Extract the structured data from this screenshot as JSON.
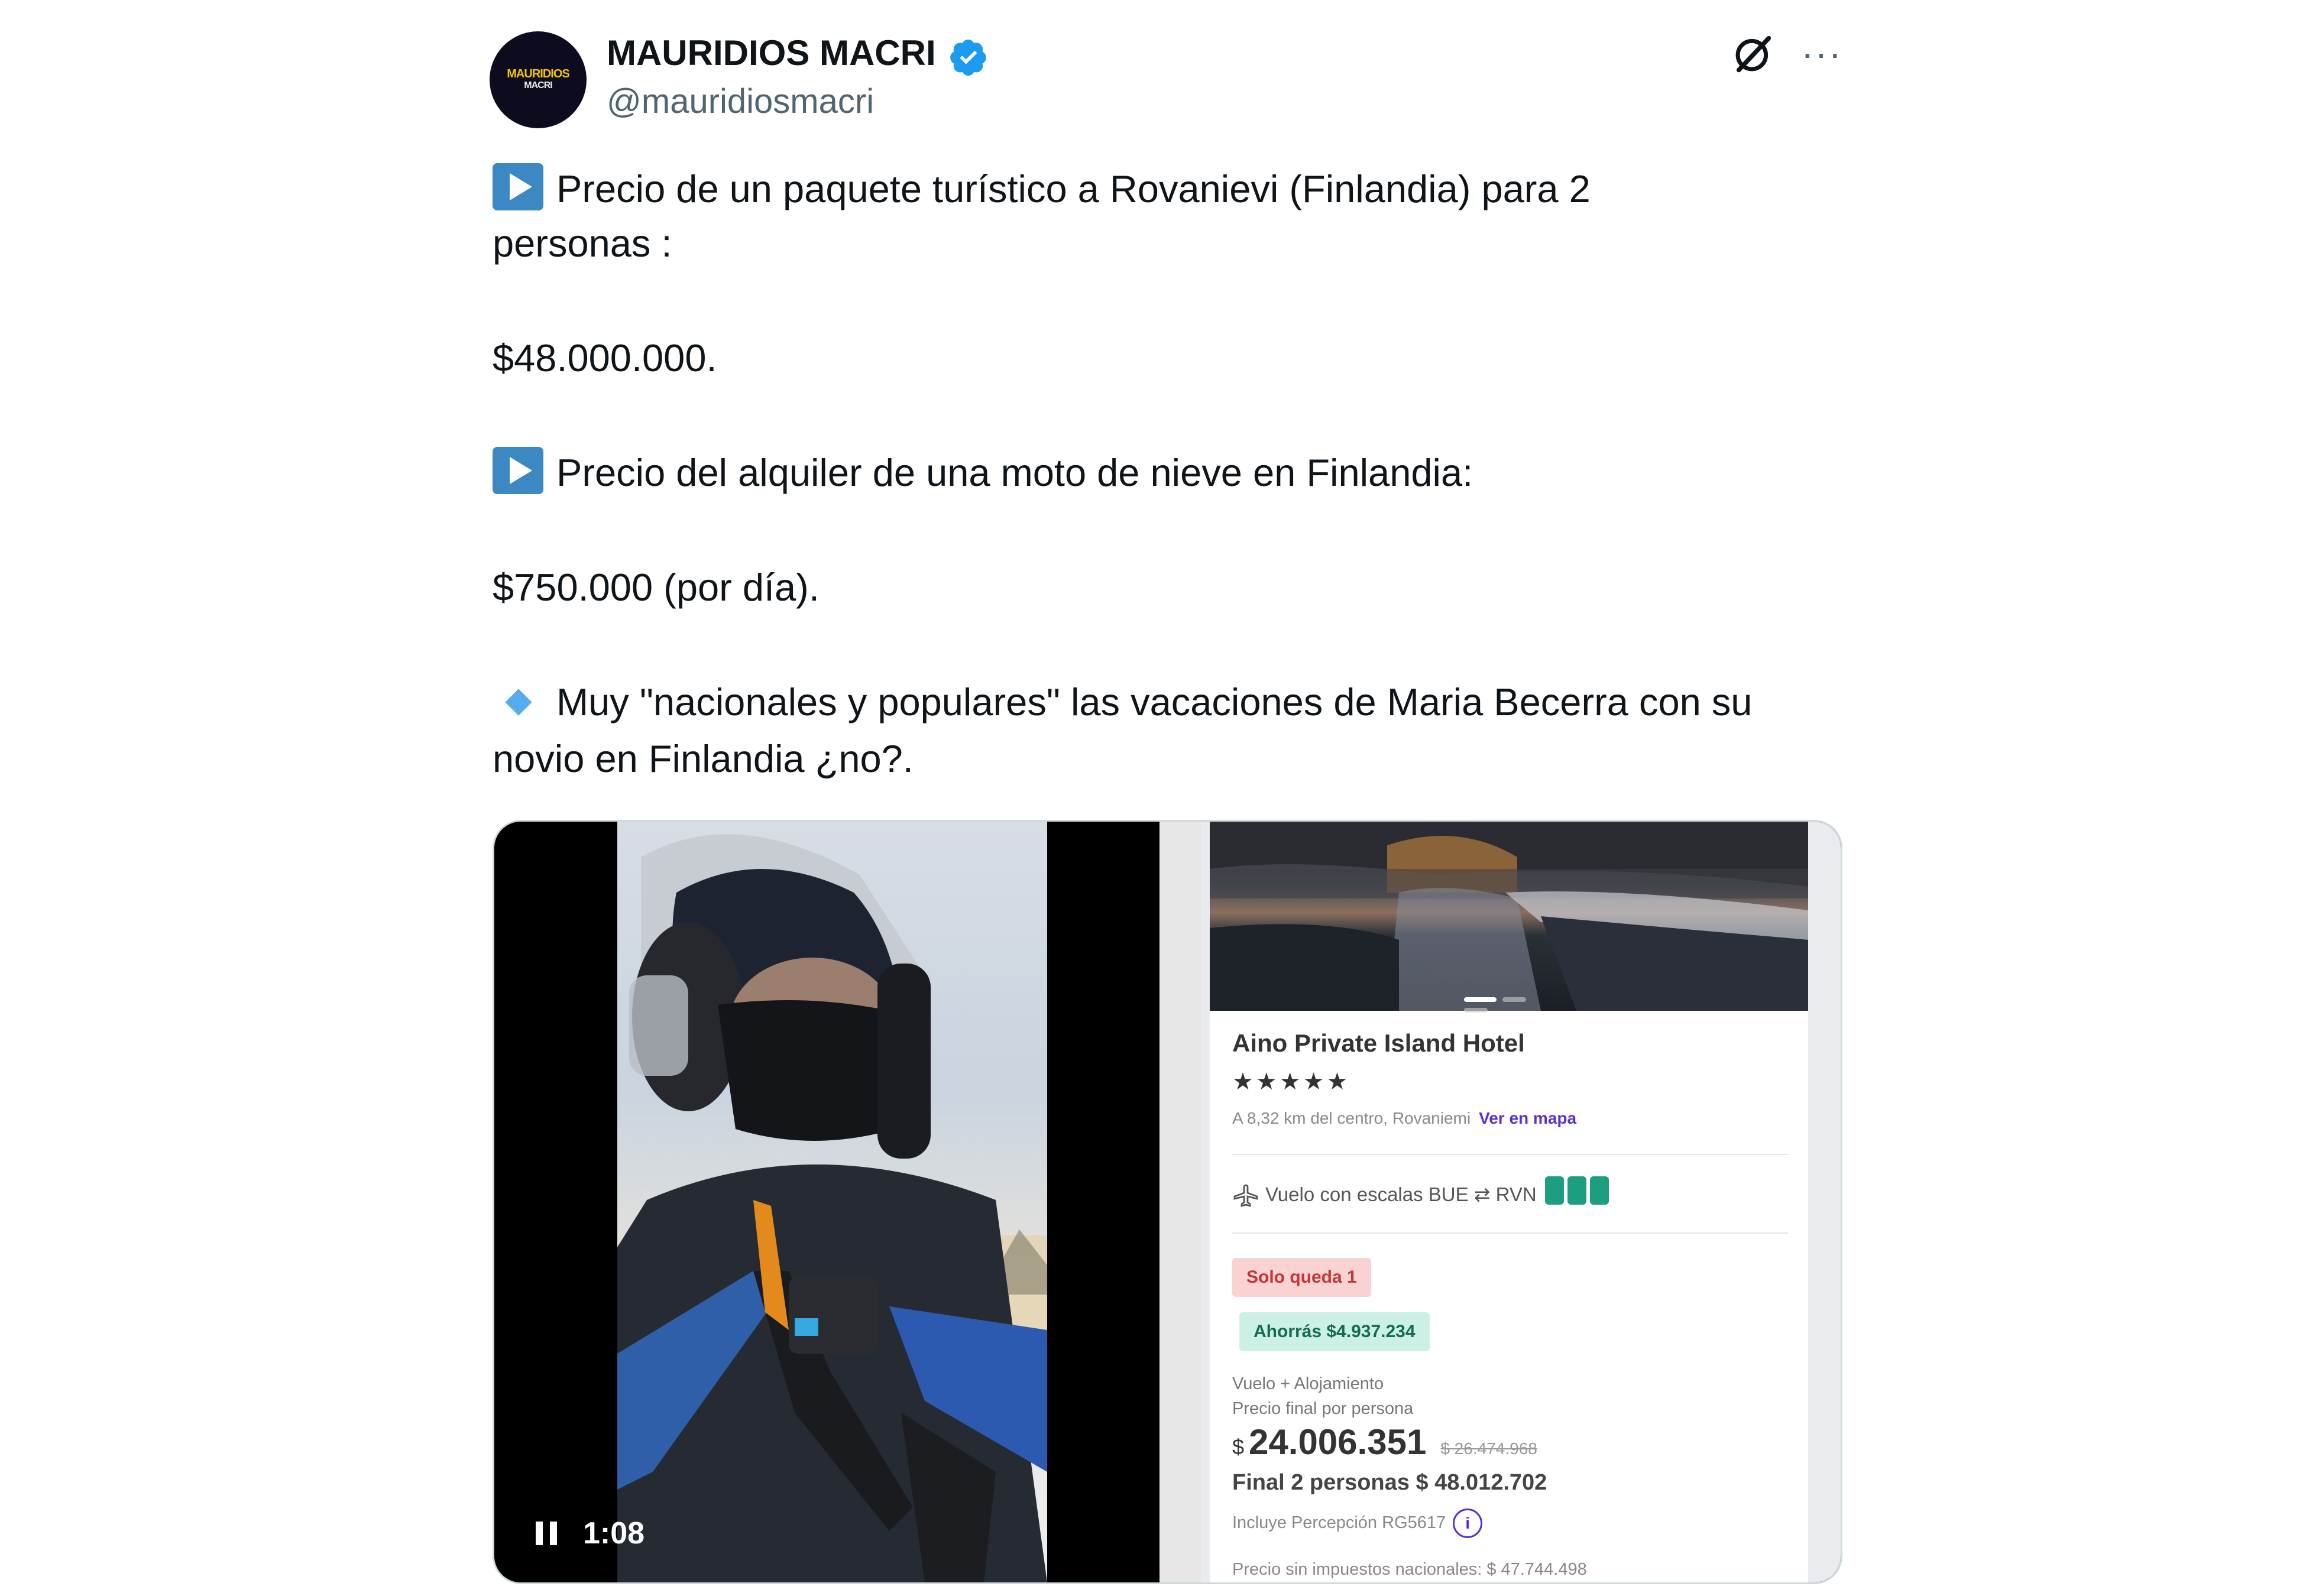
{
  "author": {
    "name": "MAURIDIOS MACRI",
    "handle": "@mauridiosmacri",
    "avatar_text_top": "MAURIDIOS",
    "avatar_text_bottom": "MACRI",
    "verified": true
  },
  "tweet": {
    "line1": "Precio de un paquete turístico a Rovanievi (Finlandia) para 2",
    "line2": "personas :",
    "line3": "$48.000.000.",
    "line4": "Precio del alquiler de una moto de nieve en Finlandia:",
    "line5": "$750.000 (por día).",
    "line6": "Muy \"nacionales y populares\" las vacaciones de Maria Becerra con su",
    "line7": "novio en Finlandia ¿no?."
  },
  "video": {
    "time": "1:08"
  },
  "hotel": {
    "title": "Aino Private Island Hotel",
    "stars": "★★★★★",
    "distance": "A 8,32 km del centro, Rovaniemi",
    "map_link": "Ver en mapa",
    "flight": "Vuelo con escalas BUE ⇄ RVN",
    "only_left": "Solo queda 1",
    "savings": "Ahorrás $4.937.234",
    "package": "Vuelo + Alojamiento",
    "per_person_label": "Precio final por persona",
    "currency": "$",
    "price": "24.006.351",
    "old_price": "$ 26.474.968",
    "final_two": "Final 2 personas $ 48.012.702",
    "includes": "Incluye Percepción RG5617",
    "info_icon": "i",
    "cut_line": "Precio sin impuestos nacionales: $ 47.744.498"
  },
  "colors": {
    "accent_blue": "#1d9bf0",
    "emoji_blue": "#3b88c3",
    "text": "#0f1419",
    "muted": "#536471"
  },
  "icons": [
    "verified-badge-icon",
    "grok-icon",
    "more-icon",
    "play-button-emoji-icon",
    "blue-diamond-emoji-icon",
    "pause-icon",
    "airplane-icon",
    "luggage-icon",
    "info-icon"
  ]
}
